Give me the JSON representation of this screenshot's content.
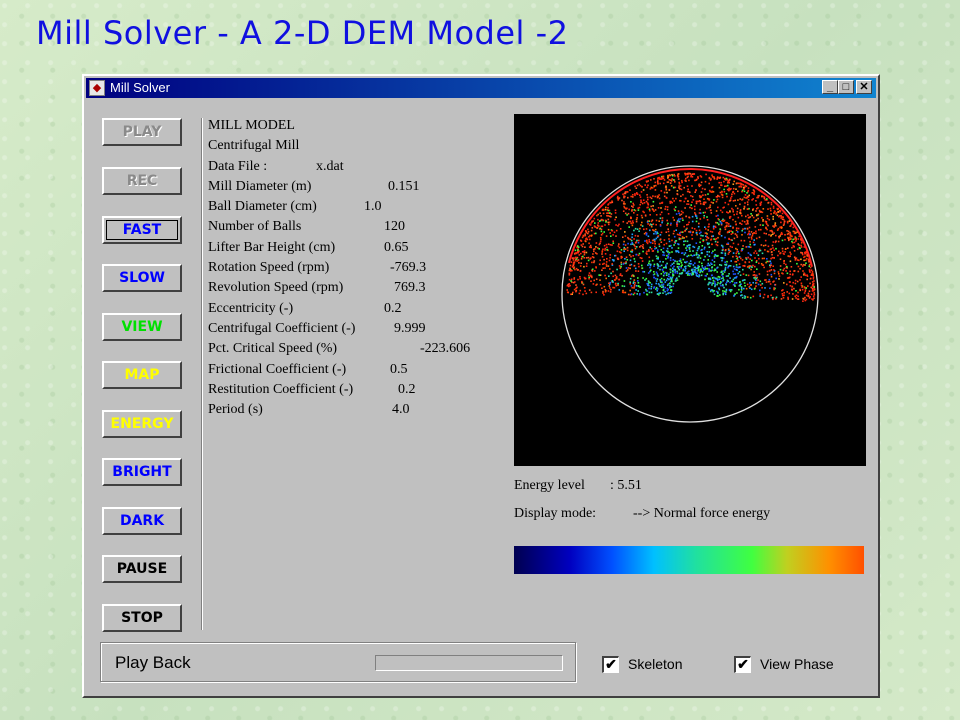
{
  "slide": {
    "title": "Mill Solver - A 2-D DEM Model -2"
  },
  "window": {
    "title": "Mill Solver",
    "controls": {
      "minimize": "_",
      "maximize": "□",
      "close": "✕"
    }
  },
  "buttons": [
    {
      "label": "PLAY",
      "color": "#8a8a8a",
      "state": "disabled"
    },
    {
      "label": "REC",
      "color": "#8a8a8a",
      "state": "disabled"
    },
    {
      "label": "FAST",
      "color": "#0000ff",
      "state": "focused"
    },
    {
      "label": "SLOW",
      "color": "#0000ff",
      "state": "normal"
    },
    {
      "label": "VIEW",
      "color": "#00e000",
      "state": "normal"
    },
    {
      "label": "MAP",
      "color": "#ffff00",
      "state": "normal"
    },
    {
      "label": "ENERGY",
      "color": "#ffff00",
      "state": "normal"
    },
    {
      "label": "BRIGHT",
      "color": "#0000ff",
      "state": "normal"
    },
    {
      "label": "DARK",
      "color": "#0000ff",
      "state": "normal"
    },
    {
      "label": "PAUSE",
      "color": "#000000",
      "state": "normal"
    },
    {
      "label": "STOP",
      "color": "#000000",
      "state": "normal"
    }
  ],
  "model": {
    "heading": "MILL MODEL",
    "type": "Centrifugal Mill",
    "params": [
      {
        "label": "Data File :",
        "value": "x.dat"
      },
      {
        "label": "Mill Diameter (m)",
        "value": "0.151"
      },
      {
        "label": "Ball Diameter (cm)",
        "value": "1.0"
      },
      {
        "label": "Number of Balls",
        "value": "120"
      },
      {
        "label": "Lifter Bar Height (cm)",
        "value": "0.65"
      },
      {
        "label": "Rotation Speed (rpm)",
        "value": "-769.3"
      },
      {
        "label": "Revolution Speed (rpm)",
        "value": "769.3"
      },
      {
        "label": "Eccentricity (-)",
        "value": "0.2"
      },
      {
        "label": "Centrifugal Coefficient (-)",
        "value": "9.999"
      },
      {
        "label": "Pct. Critical Speed (%)",
        "value": "-223.606"
      },
      {
        "label": "Frictional Coefficient (-)",
        "value": "0.5"
      },
      {
        "label": "Restitution Coefficient (-)",
        "value": "0.2"
      },
      {
        "label": "Period (s)",
        "value": "4.0"
      }
    ]
  },
  "status": {
    "energy_label": "Energy level",
    "energy_value": ": 5.51",
    "display_label": "Display mode:",
    "display_value": "--> Normal force energy"
  },
  "playback": {
    "label": "Play Back",
    "progress": 0
  },
  "checkboxes": [
    {
      "label": "Skeleton",
      "checked": true,
      "mark": "✔"
    },
    {
      "label": "View Phase",
      "checked": true,
      "mark": "✔"
    }
  ],
  "colors": {
    "title": "#1010e0",
    "window_face": "#c0c0c0",
    "viewport_bg": "#000000",
    "ring": "#e0e0e0",
    "outer_arc": "#ff2020"
  }
}
